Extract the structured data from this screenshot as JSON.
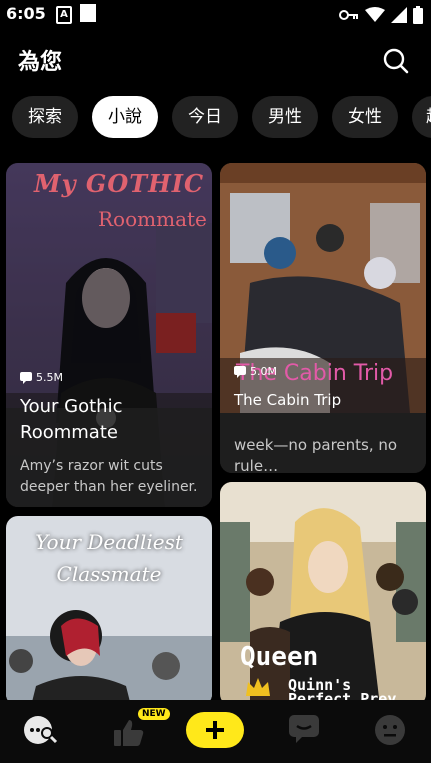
{
  "status_bar": {
    "time": "6:05",
    "a_icon_letter": "A"
  },
  "header": {
    "title": "為您"
  },
  "tabs": [
    {
      "label": "探索"
    },
    {
      "label": "小說",
      "active": true
    },
    {
      "label": "今日"
    },
    {
      "label": "男性"
    },
    {
      "label": "女性"
    },
    {
      "label": "趣"
    }
  ],
  "cards": [
    {
      "cover_title_line1": "My GOTHIC",
      "cover_title_line2": "Roommate",
      "views": "5.5M",
      "title_line1": "Your Gothic Roommate",
      "description": "Amy’s razor wit cuts deeper than her eyeliner. …"
    },
    {
      "cover_title": "The Cabin Trip",
      "views": "5.0M",
      "title_line1": "The Cabin Trip",
      "description": "week—no parents, no rule…"
    },
    {
      "cover_title_line1": "Your Deadliest",
      "cover_title_line2": "Classmate"
    },
    {
      "cover_title_line1": "Queen",
      "cover_title_line2": "Quinn's",
      "cover_title_line3": "Perfect Prey"
    }
  ],
  "nav": {
    "items": [
      {
        "icon": "chat-search-icon"
      },
      {
        "icon": "thumbs-up-icon",
        "badge": "NEW"
      },
      {
        "icon": "plus-icon"
      },
      {
        "icon": "message-icon"
      },
      {
        "icon": "face-icon"
      }
    ]
  },
  "colors": {
    "accent": "#ffe81a",
    "tab_bg": "#222222",
    "card_bg": "#1e1e1e"
  }
}
